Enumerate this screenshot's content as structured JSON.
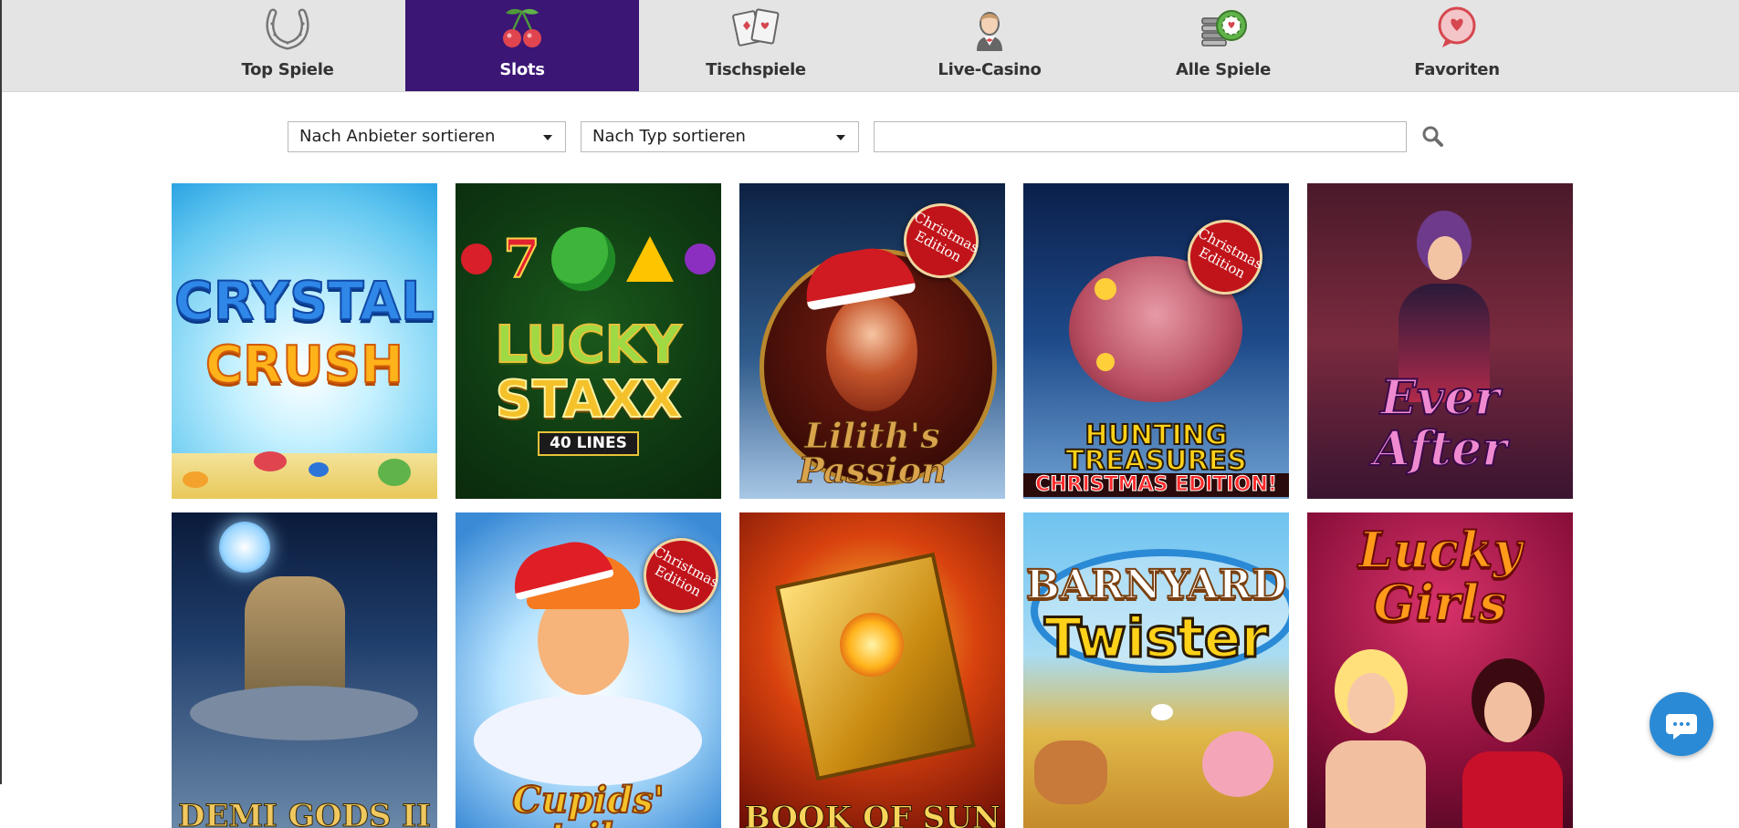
{
  "nav": {
    "tabs": [
      {
        "label": "Top Spiele",
        "icon": "horseshoe-icon",
        "active": false
      },
      {
        "label": "Slots",
        "icon": "cherries-icon",
        "active": true
      },
      {
        "label": "Tischspiele",
        "icon": "playing-cards-icon",
        "active": false
      },
      {
        "label": "Live-Casino",
        "icon": "dealer-icon",
        "active": false
      },
      {
        "label": "Alle Spiele",
        "icon": "casino-chips-icon",
        "active": false
      },
      {
        "label": "Favoriten",
        "icon": "heart-chat-icon",
        "active": false
      }
    ],
    "active_color": "#3b1675"
  },
  "filters": {
    "provider_select": "Nach Anbieter sortieren",
    "type_select": "Nach Typ sortieren",
    "search_value": "",
    "search_icon": "magnifier-icon"
  },
  "games": [
    {
      "title_line1": "CRYSTAL",
      "title_line2": "CRUSH",
      "badge": ""
    },
    {
      "title_line1": "LUCKY",
      "title_line2": "STAXX",
      "subtitle": "40 LINES",
      "badge": ""
    },
    {
      "title_line1": "Lilith's",
      "title_line2": "Passion",
      "badge": "Christmas Edition"
    },
    {
      "title_line1": "HUNTING",
      "title_line2": "TREASURES",
      "subtitle": "CHRISTMAS EDITION!",
      "badge": "Christmas Edition"
    },
    {
      "title_line1": "Ever",
      "title_line2": "After",
      "badge": ""
    },
    {
      "title_line1": "DEMI GODS II",
      "title_line2": "",
      "badge": ""
    },
    {
      "title_line1": "Cupids' strike",
      "title_line2": "",
      "badge": "Christmas Edition"
    },
    {
      "title_line1": "BOOK OF SUN",
      "title_line2": "",
      "badge": ""
    },
    {
      "title_line1": "BARNYARD",
      "title_line2": "Twister",
      "badge": ""
    },
    {
      "title_line1": "Lucky",
      "title_line2": "Girls",
      "badge": ""
    }
  ],
  "chat": {
    "icon": "chat-bubble-icon",
    "color": "#2a8ad6"
  }
}
